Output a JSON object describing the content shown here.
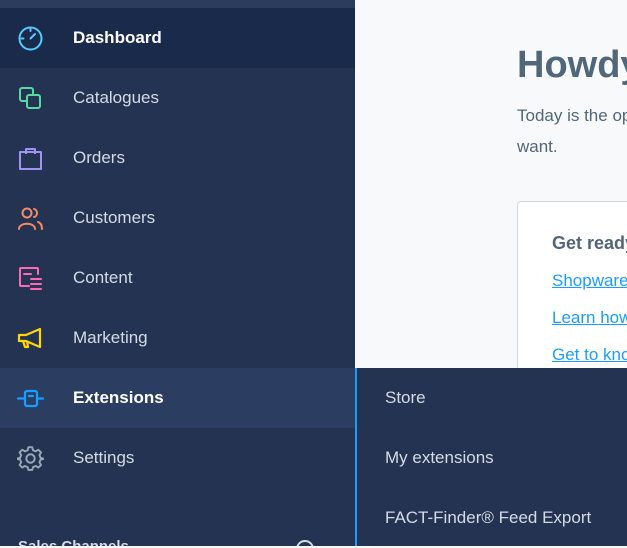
{
  "sidebar": {
    "items": [
      {
        "label": "Dashboard",
        "icon": "gauge-icon",
        "color": "#56c9ff"
      },
      {
        "label": "Catalogues",
        "icon": "catalogue-icon",
        "color": "#57d9a3"
      },
      {
        "label": "Orders",
        "icon": "shopping-bag-icon",
        "color": "#a092f0"
      },
      {
        "label": "Customers",
        "icon": "users-icon",
        "color": "#f88962"
      },
      {
        "label": "Content",
        "icon": "content-icon",
        "color": "#ff68b4"
      },
      {
        "label": "Marketing",
        "icon": "megaphone-icon",
        "color": "#ffd700"
      },
      {
        "label": "Extensions",
        "icon": "plug-icon",
        "color": "#189eff"
      },
      {
        "label": "Settings",
        "icon": "gear-icon",
        "color": "#9aa8b5"
      }
    ],
    "bottom_label": "Sales Channels"
  },
  "main": {
    "heading": "Howdy",
    "intro": "Today is the op want.",
    "card": {
      "title": "Get ready",
      "links": [
        "Shopware",
        "Learn how",
        "Get to kno"
      ]
    }
  },
  "flyout": {
    "items": [
      "Store",
      "My extensions",
      "FACT-Finder® Feed Export"
    ]
  },
  "colors": {
    "sidebar_bg": "#233351",
    "active_bg": "#1a2a4a",
    "accent": "#189eff"
  }
}
